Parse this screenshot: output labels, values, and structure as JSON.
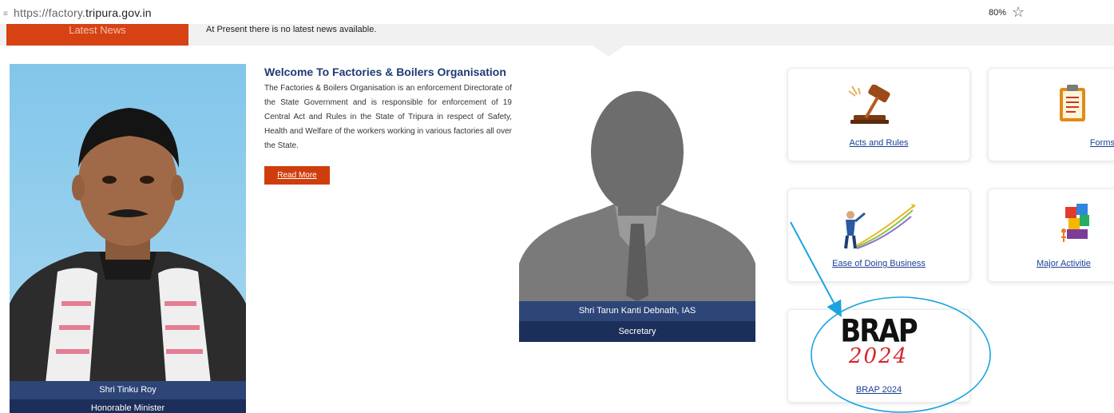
{
  "browser": {
    "url_prefix": "https://factory.",
    "url_domain": "tripura.gov.in",
    "zoom": "80%",
    "bookmark_icon": "star-icon"
  },
  "news": {
    "label": "Latest News",
    "text": "At Present there is no latest news available."
  },
  "minister": {
    "name": "Shri Tinku Roy",
    "title": "Honorable Minister"
  },
  "welcome": {
    "heading": "Welcome To Factories & Boilers Organisation",
    "body": "The Factories & Boilers Organisation is an enforcement Directorate of the State Government and is responsible for enforcement of 19 Central Act and Rules in the State of Tripura in respect of Safety, Health and Welfare of the workers working in various factories all over the State.",
    "read_more": "Read More"
  },
  "secretary": {
    "name": "Shri Tarun Kanti Debnath, IAS",
    "title": "Secretary"
  },
  "cards": {
    "acts": {
      "label": "Acts and Rules",
      "icon": "gavel-icon"
    },
    "forms": {
      "label": "Forms",
      "icon": "clipboard-icon"
    },
    "ease": {
      "label": "Ease of Doing Business",
      "icon": "growth-chart-icon"
    },
    "major": {
      "label": "Major Activitie",
      "icon": "puzzle-icon"
    },
    "brap": {
      "label": "BRAP 2024",
      "logo_top": "BRAP",
      "logo_year": "2024"
    }
  },
  "annotation_color": "#1aa3e0"
}
